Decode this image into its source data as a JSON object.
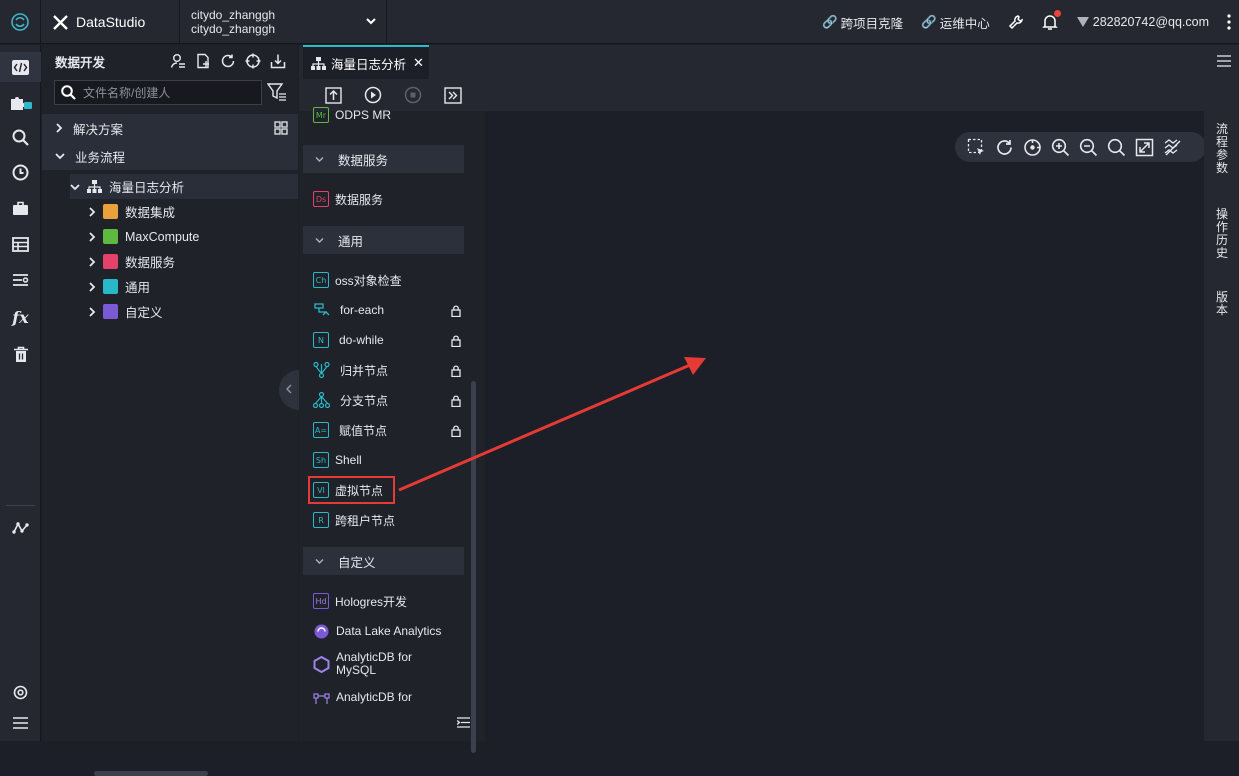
{
  "app": {
    "name": "DataStudio"
  },
  "project": {
    "line1": "citydo_zhanggh",
    "line2": "citydo_zhanggh"
  },
  "header": {
    "clone": "跨项目克隆",
    "ops": "运维中心",
    "user": "282820742@qq.com"
  },
  "sidebar": {
    "title": "数据开发",
    "search_placeholder": "文件名称/创建人",
    "solutions": "解决方案",
    "workflow": "业务流程",
    "flow_name": "海量日志分析",
    "children": [
      "数据集成",
      "MaxCompute",
      "数据服务",
      "通用",
      "自定义"
    ]
  },
  "tab": {
    "label": "海量日志分析"
  },
  "palette": {
    "top_item": "ODPS MR",
    "groups": [
      "数据服务",
      "通用",
      "自定义"
    ],
    "service_items": [
      "数据服务"
    ],
    "general_items": [
      "oss对象检查",
      "for-each",
      "do-while",
      "归并节点",
      "分支节点",
      "赋值节点",
      "Shell",
      "虚拟节点",
      "跨租户节点"
    ],
    "custom_items": [
      "Hologres开发",
      "Data Lake Analytics",
      "AnalyticDB for",
      "MySQL",
      "AnalyticDB for"
    ]
  },
  "right_panel": {
    "params": "流程参数",
    "history": "操作历史",
    "version": "版本"
  },
  "colors": {
    "accent": "#2fb8c9",
    "highlight": "#e53a35",
    "background": "#1c1f27"
  }
}
